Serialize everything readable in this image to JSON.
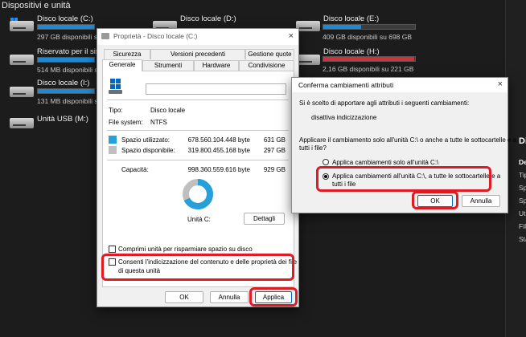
{
  "explorer": {
    "section_title": "Dispositivi e unità",
    "drives": [
      {
        "name": "Disco locale (C:)",
        "info": "297 GB disponibili su",
        "usage": 0.53,
        "bar": "blue"
      },
      {
        "name": "Disco locale (D:)",
        "info": "",
        "usage": 0,
        "bar": "none"
      },
      {
        "name": "Disco locale (E:)",
        "info": "409 GB disponibili su 698 GB",
        "usage": 0.41,
        "bar": "blue"
      },
      {
        "name": "Riservato per il siste",
        "info": "514 MB disponibili su",
        "usage": 0.8,
        "bar": "blue"
      },
      {
        "name": "Disco locale (H:)",
        "info": "2,16 GB disponibili su 221 GB",
        "usage": 0.99,
        "bar": "red"
      },
      {
        "name": "Disco locale (I:)",
        "info": "131 MB disponibili su",
        "usage": 0.9,
        "bar": "blue"
      },
      {
        "name": "Unità USB (M:)",
        "info": "",
        "usage": 0,
        "bar": "none"
      }
    ],
    "panel_labels": [
      "Di",
      "De",
      "Tip",
      "Sp",
      "Sp",
      "Ut",
      "File",
      "Sta"
    ]
  },
  "properties": {
    "title": "Proprietà - Disco locale (C:)",
    "close": "×",
    "tabs_top": [
      "Sicurezza",
      "Versioni precedenti",
      "Gestione quote"
    ],
    "tabs_bottom": [
      "Generale",
      "Strumenti",
      "Hardware",
      "Condivisione"
    ],
    "type_label": "Tipo:",
    "type_value": "Disco locale",
    "fs_label": "File system:",
    "fs_value": "NTFS",
    "used_label": "Spazio utilizzato:",
    "used_bytes": "678.560.104.448 byte",
    "used_gb": "631 GB",
    "free_label": "Spazio disponibile:",
    "free_bytes": "319.800.455.168 byte",
    "free_gb": "297 GB",
    "cap_label": "Capacità:",
    "cap_bytes": "998.360.559.616 byte",
    "cap_gb": "929 GB",
    "used_fraction": 0.68,
    "drive_label": "Unità C:",
    "details_button": "Dettagli",
    "compress_label": "Comprimi unità per risparmiare spazio su disco",
    "index_label_1": "Consenti l'indicizzazione del contenuto e delle proprietà dei file",
    "index_label_2": "di questa unità",
    "ok": "OK",
    "cancel": "Annulla",
    "apply": "Applica",
    "colors": {
      "used": "#26a0da",
      "free": "#bfbfbf",
      "highlight": "#e01b24"
    }
  },
  "confirm": {
    "title": "Conferma cambiamenti attributi",
    "close": "×",
    "intro": "Si è scelto di apportare agli attributi i seguenti cambiamenti:",
    "change": "disattiva indicizzazione",
    "question_1": "Applicare il cambiamento solo all'unità C:\\ o anche a tutte le sottocartelle e a",
    "question_2": "tutti i file?",
    "option_1": "Applica cambiamenti solo all'unità C:\\",
    "option_2a": "Applica cambiamenti all'unità C:\\, a tutte le sottocartelle e a",
    "option_2b": "tutti i file",
    "ok": "OK",
    "cancel": "Annulla"
  }
}
